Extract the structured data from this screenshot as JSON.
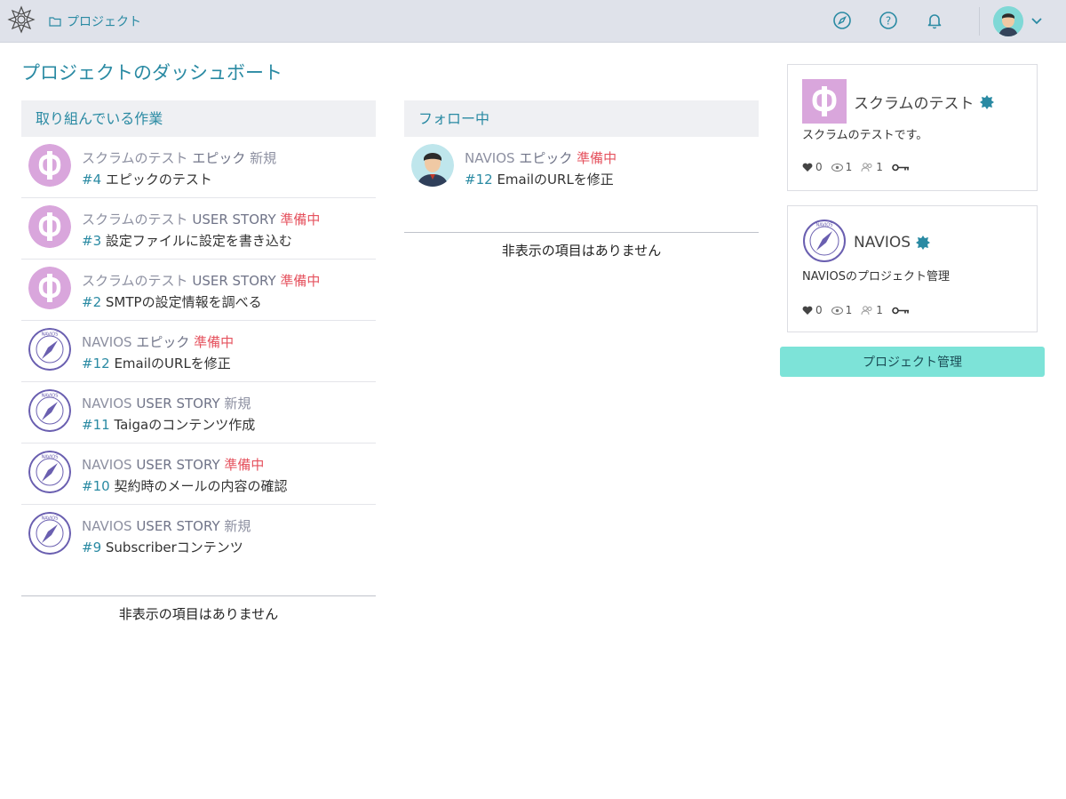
{
  "header": {
    "breadcrumb": "プロジェクト",
    "icons": [
      "compass-icon",
      "help-icon",
      "bell-icon"
    ],
    "user_menu_icon": "chevron-down-icon"
  },
  "page_title": "プロジェクトのダッシュボート",
  "working_on": {
    "heading": "取り組んでいる作業",
    "items": [
      {
        "project": "スクラムのテスト",
        "type": "エピック",
        "status": "新規",
        "status_kind": "new",
        "ref": "#4",
        "subject": "エピックのテスト",
        "avatar": "scrum"
      },
      {
        "project": "スクラムのテスト",
        "type": "USER STORY",
        "status": "準備中",
        "status_kind": "ready",
        "ref": "#3",
        "subject": "設定ファイルに設定を書き込む",
        "avatar": "scrum"
      },
      {
        "project": "スクラムのテスト",
        "type": "USER STORY",
        "status": "準備中",
        "status_kind": "ready",
        "ref": "#2",
        "subject": "SMTPの設定情報を調べる",
        "avatar": "scrum"
      },
      {
        "project": "NAVIOS",
        "type": "エピック",
        "status": "準備中",
        "status_kind": "ready",
        "ref": "#12",
        "subject": "EmailのURLを修正",
        "avatar": "navios"
      },
      {
        "project": "NAVIOS",
        "type": "USER STORY",
        "status": "新規",
        "status_kind": "new",
        "ref": "#11",
        "subject": "Taigaのコンテンツ作成",
        "avatar": "navios"
      },
      {
        "project": "NAVIOS",
        "type": "USER STORY",
        "status": "準備中",
        "status_kind": "ready",
        "ref": "#10",
        "subject": "契約時のメールの内容の確認",
        "avatar": "navios"
      },
      {
        "project": "NAVIOS",
        "type": "USER STORY",
        "status": "新規",
        "status_kind": "new",
        "ref": "#9",
        "subject": "Subscriberコンテンツ",
        "avatar": "navios"
      }
    ],
    "empty_text": "非表示の項目はありません"
  },
  "following": {
    "heading": "フォロー中",
    "items": [
      {
        "project": "NAVIOS",
        "type": "エピック",
        "status": "準備中",
        "status_kind": "ready",
        "ref": "#12",
        "subject": "EmailのURLを修正",
        "avatar": "user"
      }
    ],
    "empty_text": "非表示の項目はありません"
  },
  "projects": [
    {
      "name": "スクラムのテスト",
      "description": "スクラムのテストです。",
      "likes": "0",
      "watchers": "1",
      "members": "1",
      "thumb": "scrum"
    },
    {
      "name": "NAVIOS",
      "description": "NAVIOSのプロジェクト管理",
      "likes": "0",
      "watchers": "1",
      "members": "1",
      "thumb": "navios"
    }
  ],
  "manage_button": "プロジェクト管理",
  "colors": {
    "accent": "#2a8aa3",
    "ready": "#e5525e",
    "button": "#7de3d8",
    "scrum_avatar": "#d9a6dc",
    "navios_ring": "#6a5fb0"
  }
}
